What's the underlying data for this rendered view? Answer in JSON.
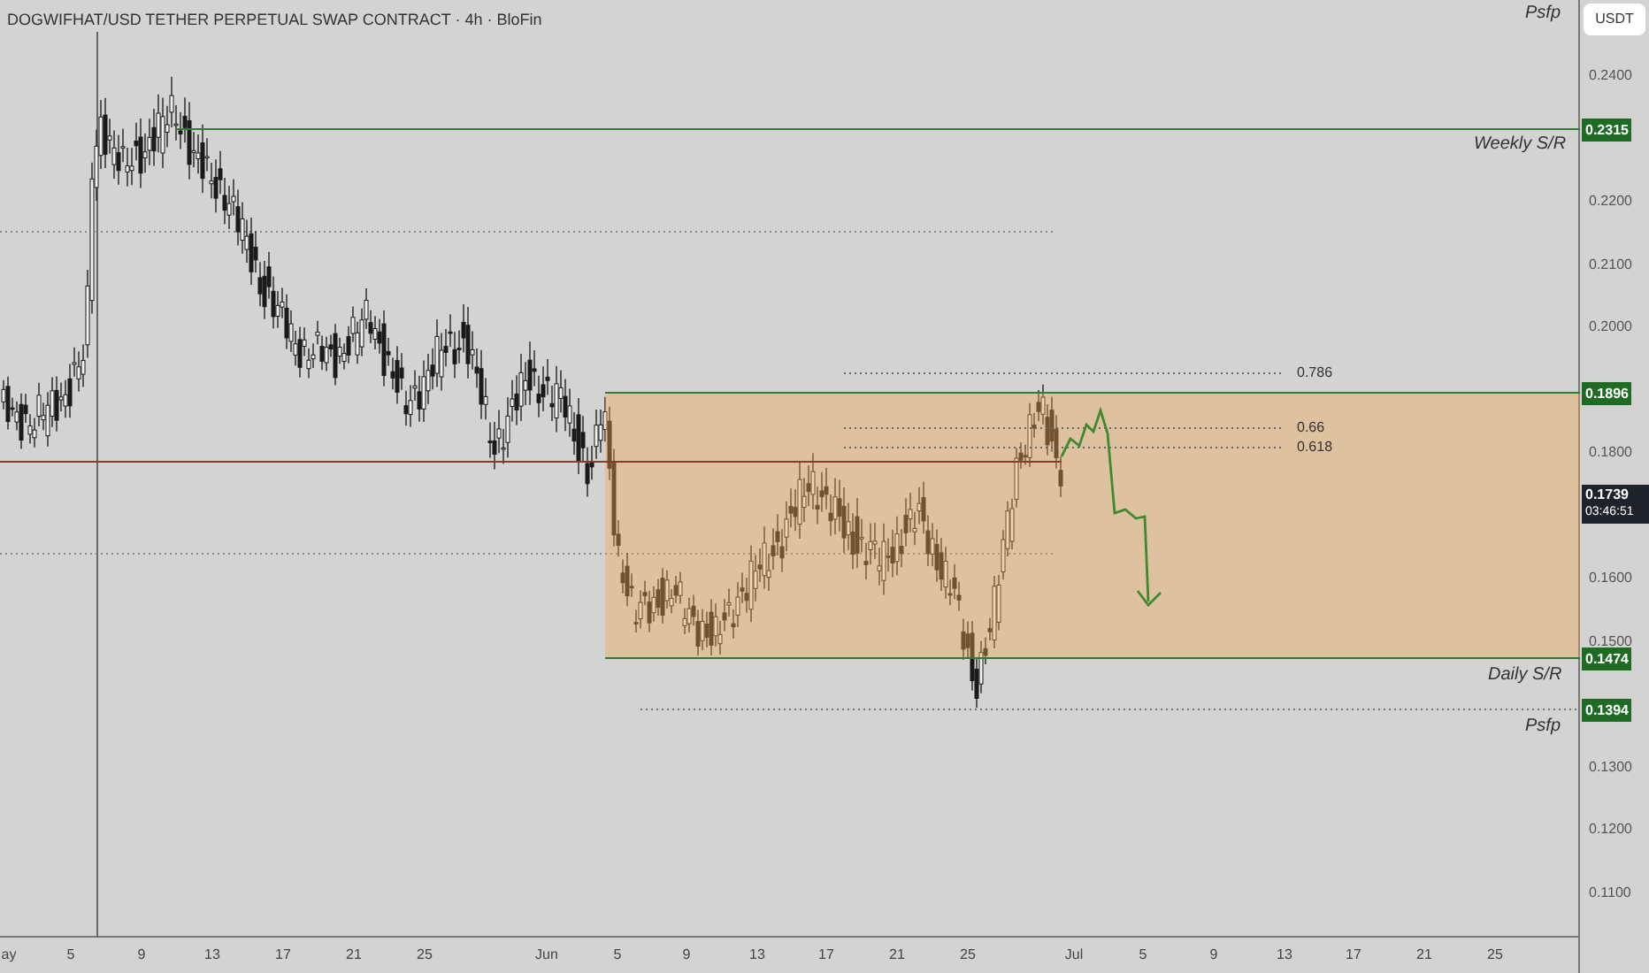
{
  "header": {
    "title": "DOGWIFHAT/USD TETHER PERPETUAL SWAP CONTRACT · 4h · BloFin"
  },
  "annotations": [
    {
      "text": "Psfp"
    },
    {
      "text": "Weekly S/R"
    },
    {
      "text": "Daily S/R"
    },
    {
      "text": "Psfp"
    }
  ],
  "fib_levels": [
    {
      "label": "0.786"
    },
    {
      "label": "0.66"
    },
    {
      "label": "0.618"
    }
  ],
  "price_axis": {
    "currency": "USDT",
    "ticks": [
      "0.2400",
      "0.2200",
      "0.2100",
      "0.2000",
      "0.1800",
      "0.1600",
      "0.1500",
      "0.1300",
      "0.1200",
      "0.1100"
    ]
  },
  "price_badges": [
    {
      "kind": "level",
      "value": "0.2315"
    },
    {
      "kind": "level",
      "value": "0.1896"
    },
    {
      "kind": "last",
      "value": "0.1739",
      "countdown": "03:46:51"
    },
    {
      "kind": "level",
      "value": "0.1474"
    },
    {
      "kind": "level",
      "value": "0.1394"
    }
  ],
  "time_axis": {
    "ticks": [
      "ay",
      "5",
      "9",
      "13",
      "17",
      "21",
      "25",
      "Jun",
      "5",
      "9",
      "13",
      "17",
      "21",
      "25",
      "Jul",
      "5",
      "9",
      "13",
      "17",
      "21",
      "25"
    ]
  }
}
